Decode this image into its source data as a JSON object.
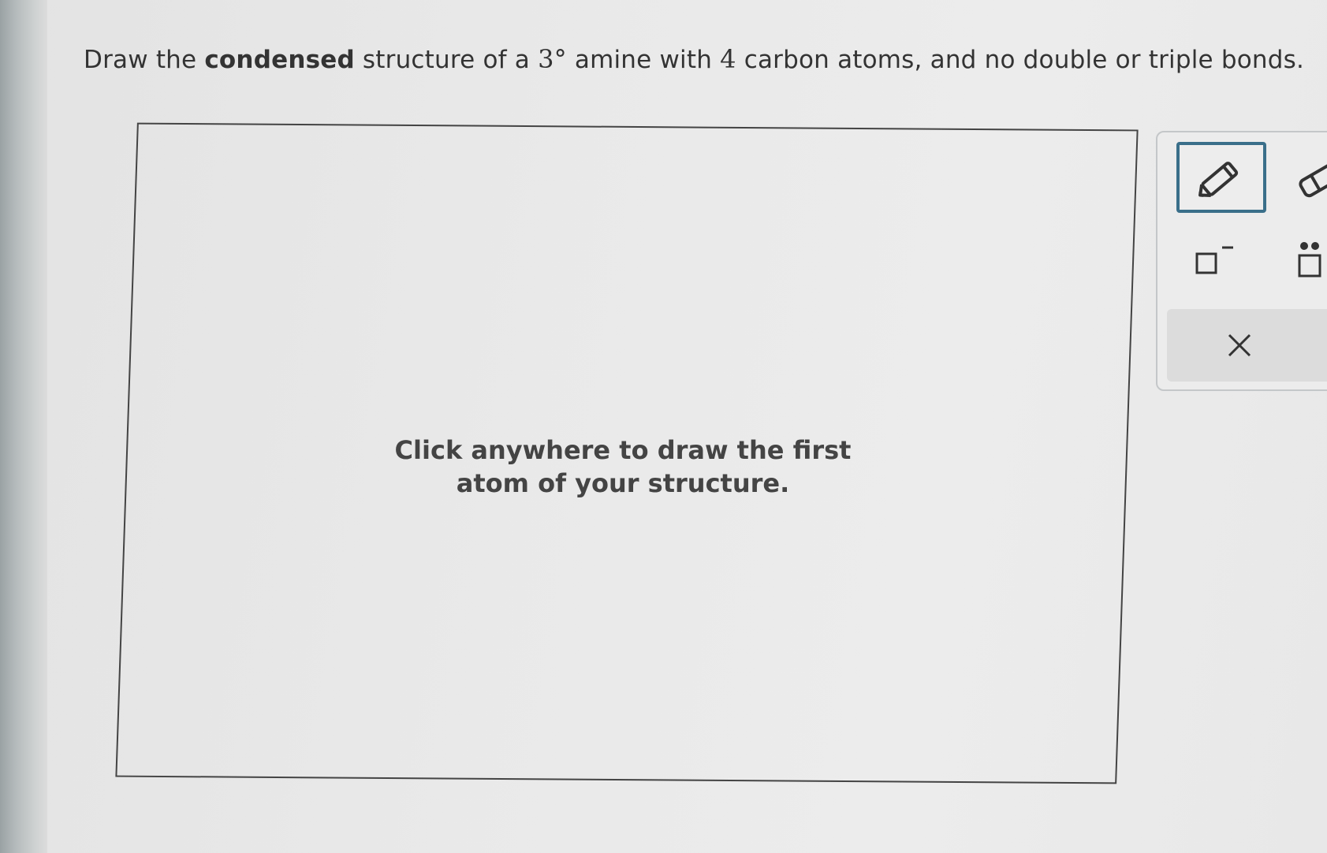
{
  "question": {
    "prefix": "Draw the",
    "bold": "condensed",
    "middle": "structure of a",
    "degree_num": "3",
    "degree_sign": "°",
    "after_degree": "amine with",
    "carbon_num": "4",
    "suffix": "carbon atoms, and no double or triple bonds."
  },
  "canvas": {
    "hint_line1": "Click anywhere to draw the first",
    "hint_line2": "atom of your structure."
  },
  "toolbar": {
    "tools": [
      {
        "name": "pencil-icon",
        "selected": true
      },
      {
        "name": "eraser-icon",
        "selected": false
      },
      {
        "name": "negative-charge-icon",
        "selected": false
      },
      {
        "name": "lone-pair-icon",
        "selected": false
      },
      {
        "name": "close-icon",
        "selected": false
      }
    ],
    "accent_color": "#3a6f8a"
  }
}
